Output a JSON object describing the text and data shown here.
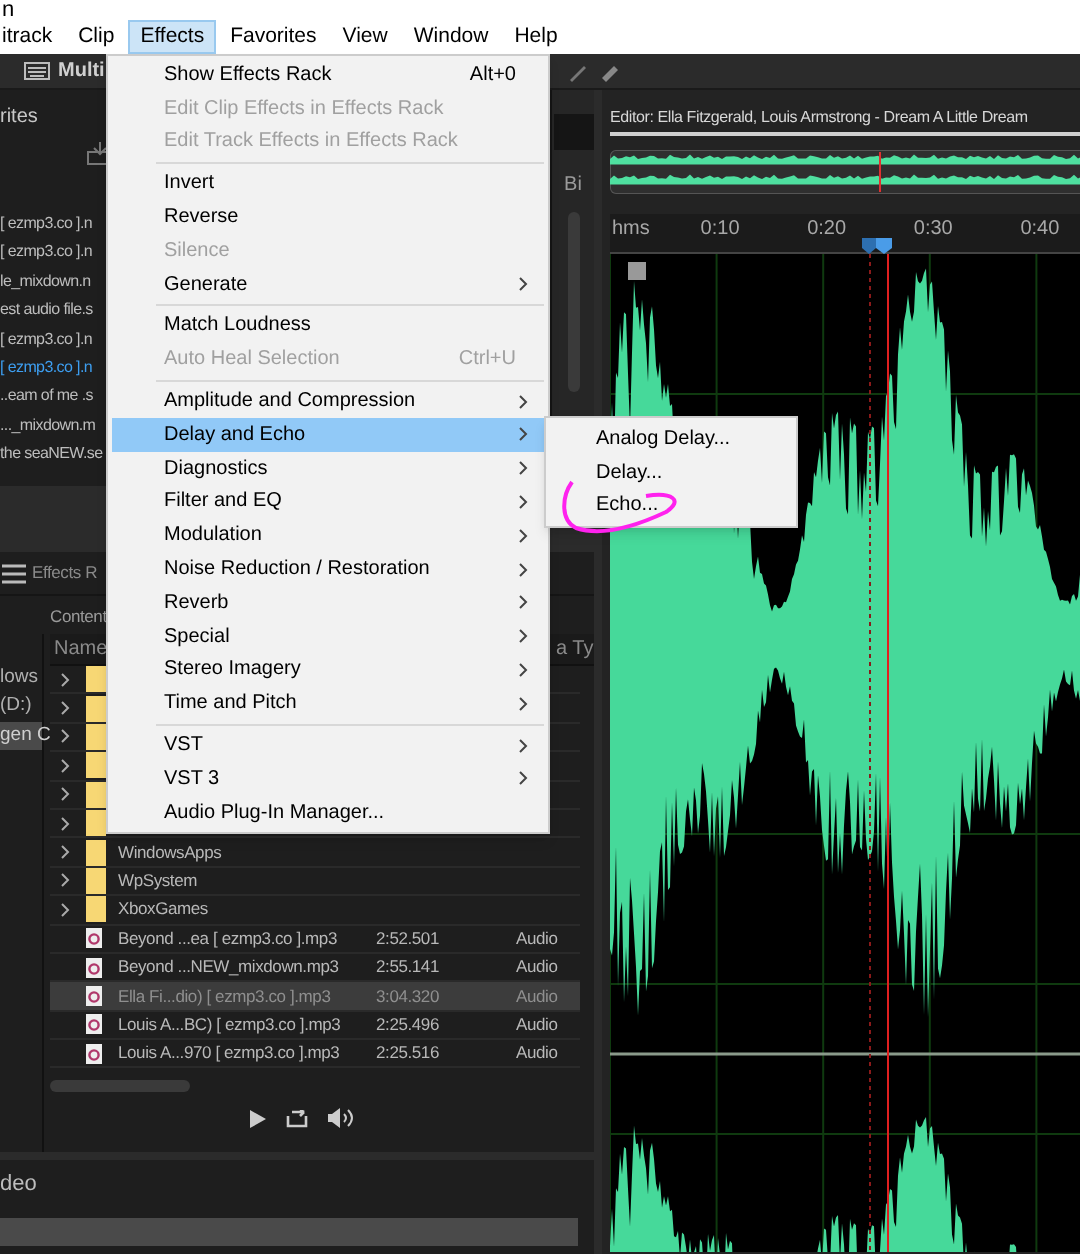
{
  "title_fragment": "n",
  "menu_bar": [
    {
      "label": "itrack",
      "selected": false
    },
    {
      "label": "Clip",
      "selected": false
    },
    {
      "label": "Effects",
      "selected": true
    },
    {
      "label": "Favorites",
      "selected": false
    },
    {
      "label": "View",
      "selected": false
    },
    {
      "label": "Window",
      "selected": false
    },
    {
      "label": "Help",
      "selected": false
    }
  ],
  "toolbar": {
    "workspace_label": "Multi"
  },
  "files_panel": {
    "title": "rites",
    "items": [
      {
        "label": "[ ezmp3.co ].n",
        "selected": false
      },
      {
        "label": "[ ezmp3.co ].n",
        "selected": false
      },
      {
        "label": "le_mixdown.n",
        "selected": false
      },
      {
        "label": "est audio file.s",
        "selected": false
      },
      {
        "label": "[ ezmp3.co ].n",
        "selected": false
      },
      {
        "label": "[ ezmp3.co ].n",
        "selected": true
      },
      {
        "label": "..eam of me .s",
        "selected": false
      },
      {
        "label": "..._mixdown.m",
        "selected": false
      },
      {
        "label": "the seaNEW.se",
        "selected": false
      }
    ]
  },
  "side_column_label": "Bi",
  "media_browser": {
    "tabs": [
      {
        "label": "Effects R",
        "selected": false
      }
    ],
    "content_label": "Content",
    "locations": [
      {
        "label": "lows",
        "selected": false
      },
      {
        "label": "(D:)",
        "selected": false
      },
      {
        "label": "gen C",
        "selected": true
      }
    ],
    "columns": [
      "Name",
      "a Ty"
    ],
    "rows": [
      {
        "kind": "folder",
        "selected": false
      },
      {
        "kind": "folder",
        "selected": false
      },
      {
        "kind": "folder",
        "selected": false
      },
      {
        "kind": "folder",
        "selected": false
      },
      {
        "kind": "folder",
        "selected": false
      },
      {
        "kind": "folder",
        "selected": false
      },
      {
        "kind": "folder",
        "name": "WindowsApps",
        "selected": false
      },
      {
        "kind": "folder",
        "name": "WpSystem",
        "selected": false
      },
      {
        "kind": "folder",
        "name": "XboxGames",
        "selected": false
      },
      {
        "kind": "file",
        "name": "Beyond ...ea [ ezmp3.co ].mp3",
        "duration": "2:52.501",
        "type": "Audio",
        "selected": false
      },
      {
        "kind": "file",
        "name": "Beyond ...NEW_mixdown.mp3",
        "duration": "2:55.141",
        "type": "Audio",
        "selected": false
      },
      {
        "kind": "file",
        "name": "Ella Fi...dio) [ ezmp3.co ].mp3",
        "duration": "3:04.320",
        "type": "Audio",
        "selected": true
      },
      {
        "kind": "file",
        "name": "Louis A...BC) [ ezmp3.co ].mp3",
        "duration": "2:25.496",
        "type": "Audio",
        "selected": false
      },
      {
        "kind": "file",
        "name": "Louis A...970 [ ezmp3.co ].mp3",
        "duration": "2:25.516",
        "type": "Audio",
        "selected": false
      }
    ]
  },
  "bottom_panel": {
    "title": "deo"
  },
  "editor": {
    "title": "Editor: Ella Fitzgerald, Louis Armstrong - Dream A Little Dream",
    "ruler": [
      "hms",
      "0:10",
      "0:20",
      "0:30",
      "0:40"
    ]
  },
  "effects_menu": {
    "items": [
      {
        "kind": "item",
        "label": "Show Effects Rack",
        "shortcut": "Alt+0",
        "disabled": false,
        "submenu": false,
        "selected": false
      },
      {
        "kind": "item",
        "label": "Edit Clip Effects in Effects Rack",
        "disabled": true,
        "submenu": false,
        "selected": false
      },
      {
        "kind": "item",
        "label": "Edit Track Effects in Effects Rack",
        "disabled": true,
        "submenu": false,
        "selected": false
      },
      {
        "kind": "separator"
      },
      {
        "kind": "item",
        "label": "Invert",
        "disabled": false,
        "submenu": false,
        "selected": false
      },
      {
        "kind": "item",
        "label": "Reverse",
        "disabled": false,
        "submenu": false,
        "selected": false
      },
      {
        "kind": "item",
        "label": "Silence",
        "disabled": true,
        "submenu": false,
        "selected": false
      },
      {
        "kind": "item",
        "label": "Generate",
        "disabled": false,
        "submenu": true,
        "selected": false
      },
      {
        "kind": "separator"
      },
      {
        "kind": "item",
        "label": "Match Loudness",
        "disabled": false,
        "submenu": false,
        "selected": false
      },
      {
        "kind": "item",
        "label": "Auto Heal Selection",
        "shortcut": "Ctrl+U",
        "disabled": true,
        "submenu": false,
        "selected": false
      },
      {
        "kind": "separator"
      },
      {
        "kind": "item",
        "label": "Amplitude and Compression",
        "disabled": false,
        "submenu": true,
        "selected": false
      },
      {
        "kind": "item",
        "label": "Delay and Echo",
        "disabled": false,
        "submenu": true,
        "selected": true
      },
      {
        "kind": "item",
        "label": "Diagnostics",
        "disabled": false,
        "submenu": true,
        "selected": false
      },
      {
        "kind": "item",
        "label": "Filter and EQ",
        "disabled": false,
        "submenu": true,
        "selected": false
      },
      {
        "kind": "item",
        "label": "Modulation",
        "disabled": false,
        "submenu": true,
        "selected": false
      },
      {
        "kind": "item",
        "label": "Noise Reduction / Restoration",
        "disabled": false,
        "submenu": true,
        "selected": false
      },
      {
        "kind": "item",
        "label": "Reverb",
        "disabled": false,
        "submenu": true,
        "selected": false
      },
      {
        "kind": "item",
        "label": "Special",
        "disabled": false,
        "submenu": true,
        "selected": false
      },
      {
        "kind": "item",
        "label": "Stereo Imagery",
        "disabled": false,
        "submenu": true,
        "selected": false
      },
      {
        "kind": "item",
        "label": "Time and Pitch",
        "disabled": false,
        "submenu": true,
        "selected": false
      },
      {
        "kind": "separator"
      },
      {
        "kind": "item",
        "label": "VST",
        "disabled": false,
        "submenu": true,
        "selected": false
      },
      {
        "kind": "item",
        "label": "VST 3",
        "disabled": false,
        "submenu": true,
        "selected": false
      },
      {
        "kind": "item",
        "label": "Audio Plug-In Manager...",
        "disabled": false,
        "submenu": false,
        "selected": false
      }
    ]
  },
  "delay_submenu": {
    "items": [
      {
        "label": "Analog Delay...",
        "circled": false
      },
      {
        "label": "Delay...",
        "circled": false
      },
      {
        "label": "Echo...",
        "circled": true
      }
    ]
  }
}
